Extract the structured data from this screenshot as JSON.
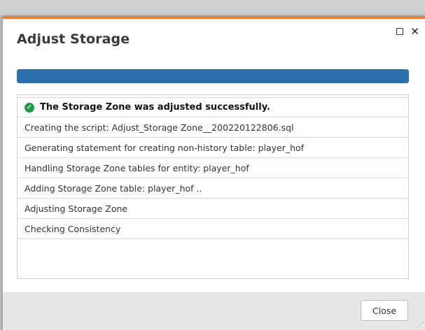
{
  "dialog": {
    "title": "Adjust Storage",
    "progress": 1.0,
    "accent_color": "#f07e2a",
    "progress_color": "#2d6fab",
    "window_controls": {
      "maximize_icon": "maximize-icon",
      "close_icon": "close-icon"
    }
  },
  "log": {
    "success_message": "The Storage Zone was adjusted successfully.",
    "success_icon": "check-circle-icon",
    "success_color": "#1e9a48",
    "entries": [
      "Creating the script: Adjust_Storage Zone__200220122806.sql",
      "Generating statement for creating non-history table: player_hof",
      "Handling Storage Zone tables for entity: player_hof",
      "Adding Storage Zone table: player_hof ..",
      "Adjusting Storage Zone",
      "Checking Consistency"
    ]
  },
  "footer": {
    "close_label": "Close"
  }
}
